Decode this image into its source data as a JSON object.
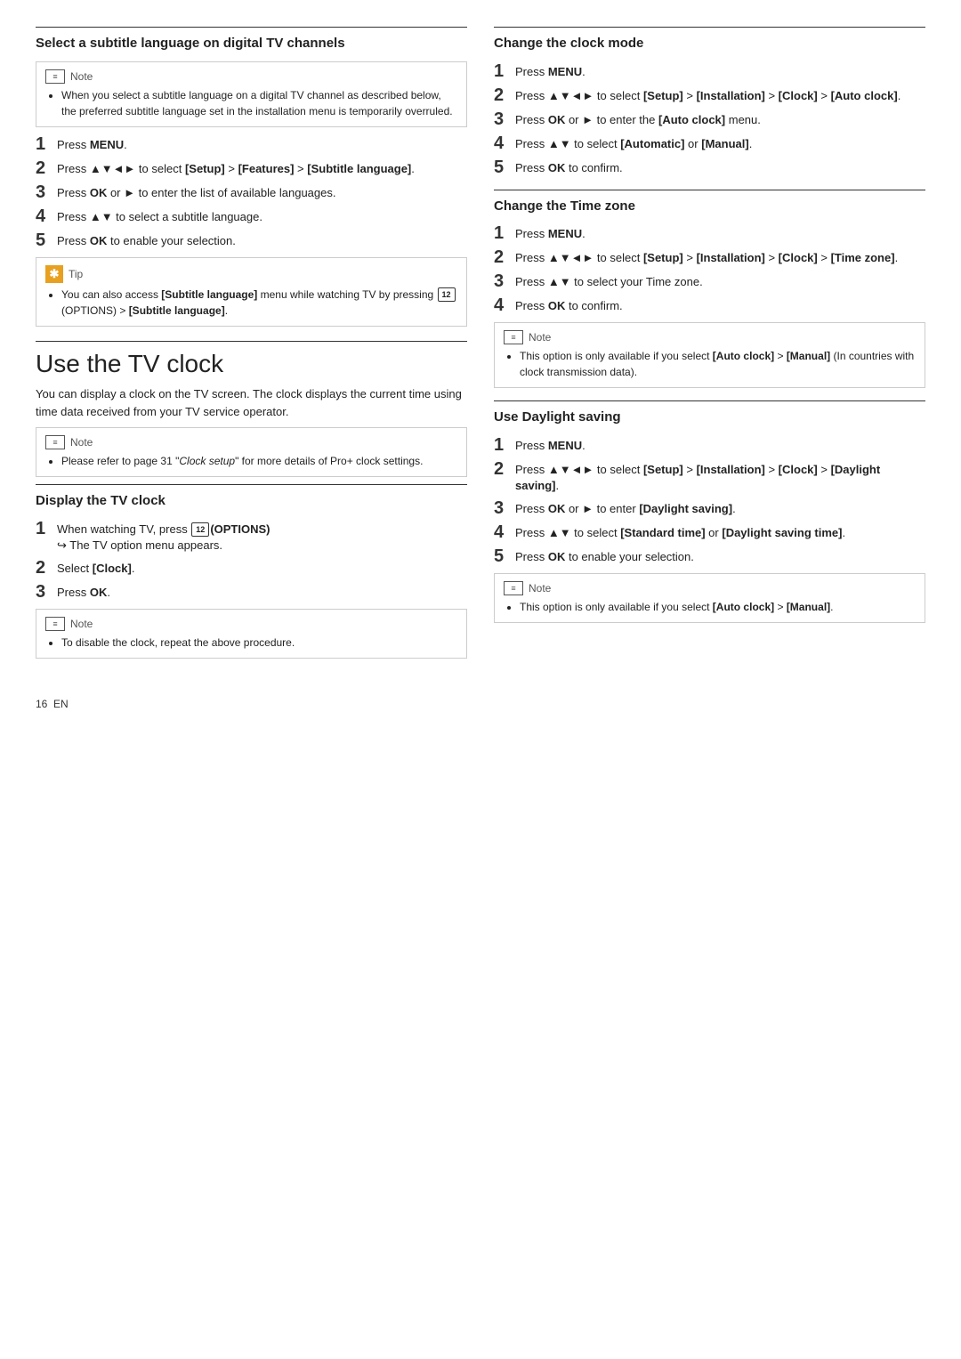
{
  "left": {
    "section1": {
      "title": "Select a subtitle language on digital TV channels",
      "note": {
        "label": "Note",
        "items": [
          "When you select a subtitle language on a digital TV channel as described below, the preferred subtitle language set in the installation menu is temporarily overruled."
        ]
      },
      "steps": [
        {
          "num": "1",
          "text": "Press <b>MENU</b>."
        },
        {
          "num": "2",
          "text": "Press ▲▼◄► to select <b>[Setup]</b> > <b>[Features]</b> > <b>[Subtitle language]</b>."
        },
        {
          "num": "3",
          "text": "Press <b>OK</b> or ► to enter the list of available languages."
        },
        {
          "num": "4",
          "text": "Press ▲▼ to select a subtitle language."
        },
        {
          "num": "5",
          "text": "Press <b>OK</b> to enable your selection."
        }
      ],
      "tip": {
        "label": "Tip",
        "items": [
          "You can also access <b>[Subtitle language]</b> menu while watching TV by pressing <span class='options-icon'>12</span> (OPTIONS) > <b>[Subtitle language]</b>."
        ]
      }
    },
    "use_tv_clock": {
      "big_title": "Use the TV clock",
      "body": "You can display a clock on the TV screen. The clock displays the current time using time data received from your TV service operator.",
      "note": {
        "label": "Note",
        "items": [
          "Please refer to page 31 \"<i>Clock setup</i>\" for more details of Pro+ clock settings."
        ]
      },
      "display_tv_clock": {
        "title": "Display the TV clock",
        "steps": [
          {
            "num": "1",
            "text": "When watching TV, press <span class='options-icon'>12</span><b>(OPTIONS)</b> ↪ The TV option menu appears."
          },
          {
            "num": "2",
            "text": "Select <b>[Clock]</b>."
          },
          {
            "num": "3",
            "text": "Press <b>OK</b>."
          }
        ],
        "note": {
          "label": "Note",
          "items": [
            "To disable the clock, repeat the above procedure."
          ]
        }
      }
    }
  },
  "right": {
    "change_clock_mode": {
      "title": "Change the clock mode",
      "steps": [
        {
          "num": "1",
          "text": "Press <b>MENU</b>."
        },
        {
          "num": "2",
          "text": "Press ▲▼◄► to select <b>[Setup]</b> > <b>[Installation]</b> > <b>[Clock]</b> > <b>[Auto clock]</b>."
        },
        {
          "num": "3",
          "text": "Press <b>OK</b> or ► to enter the <b>[Auto clock]</b> menu."
        },
        {
          "num": "4",
          "text": "Press ▲▼ to select <b>[Automatic]</b> or <b>[Manual]</b>."
        },
        {
          "num": "5",
          "text": "Press <b>OK</b> to confirm."
        }
      ]
    },
    "change_time_zone": {
      "title": "Change the Time zone",
      "steps": [
        {
          "num": "1",
          "text": "Press <b>MENU</b>."
        },
        {
          "num": "2",
          "text": "Press ▲▼◄► to select <b>[Setup]</b> > <b>[Installation]</b> > <b>[Clock]</b> > <b>[Time zone]</b>."
        },
        {
          "num": "3",
          "text": "Press ▲▼ to select your Time zone."
        },
        {
          "num": "4",
          "text": "Press <b>OK</b> to confirm."
        }
      ],
      "note": {
        "label": "Note",
        "items": [
          "This option is only available if you select <b>[Auto clock]</b> > <b>[Manual]</b> (In countries with clock transmission data)."
        ]
      }
    },
    "use_daylight_saving": {
      "title": "Use Daylight saving",
      "steps": [
        {
          "num": "1",
          "text": "Press <b>MENU</b>."
        },
        {
          "num": "2",
          "text": "Press ▲▼◄► to select <b>[Setup]</b> > <b>[Installation]</b> > <b>[Clock]</b> > <b>[Daylight saving]</b>."
        },
        {
          "num": "3",
          "text": "Press <b>OK</b> or ► to enter <b>[Daylight saving]</b>."
        },
        {
          "num": "4",
          "text": "Press ▲▼ to select <b>[Standard time]</b> or <b>[Daylight saving time]</b>."
        },
        {
          "num": "5",
          "text": "Press <b>OK</b> to enable your selection."
        }
      ],
      "note": {
        "label": "Note",
        "items": [
          "This option is only available if you select <b>[Auto clock]</b> > <b>[Manual]</b>."
        ]
      }
    }
  },
  "footer": {
    "page_num": "16",
    "lang": "EN"
  }
}
